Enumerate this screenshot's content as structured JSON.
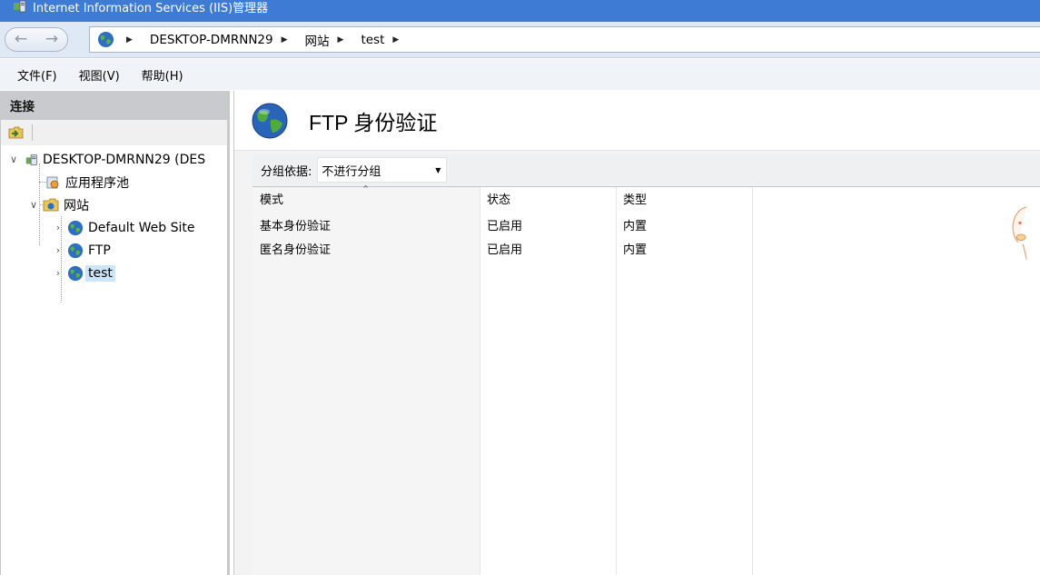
{
  "window": {
    "title": "Internet Information Services (IIS)管理器",
    "accent_color": "#3d7bd4"
  },
  "address": {
    "back_icon": "back-arrow-icon",
    "forward_icon": "forward-arrow-icon",
    "breadcrumbs": [
      "DESKTOP-DMRNN29",
      "网站",
      "test"
    ]
  },
  "menu": {
    "items": [
      "文件(F)",
      "视图(V)",
      "帮助(H)"
    ]
  },
  "connections": {
    "header": "连接",
    "tree": {
      "server": "DESKTOP-DMRNN29 (DES",
      "app_pools": "应用程序池",
      "sites": "网站",
      "site_items": [
        "Default Web Site",
        "FTP",
        "test"
      ],
      "selected": "test"
    }
  },
  "feature": {
    "title": "FTP 身份验证",
    "group_label": "分组依据:",
    "group_value": "不进行分组",
    "columns": [
      "模式",
      "状态",
      "类型"
    ],
    "rows": [
      {
        "mode": "基本身份验证",
        "status": "已启用",
        "type": "内置"
      },
      {
        "mode": "匿名身份验证",
        "status": "已启用",
        "type": "内置"
      }
    ]
  }
}
